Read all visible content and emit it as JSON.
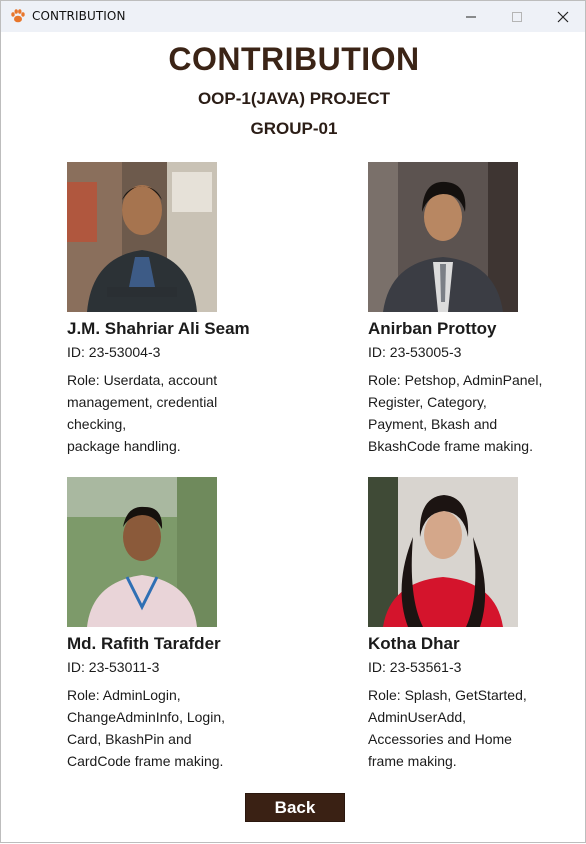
{
  "window": {
    "title": "CONTRIBUTION"
  },
  "header": {
    "title": "CONTRIBUTION",
    "subtitle": "OOP-1(JAVA) PROJECT",
    "group": "GROUP-01"
  },
  "members": [
    {
      "name": "J.M. Shahriar Ali Seam",
      "id": "ID: 23-53004-3",
      "role": "Role: Userdata, account\nmanagement, credential\nchecking,\npackage handling."
    },
    {
      "name": "Anirban Prottoy",
      "id": "ID: 23-53005-3",
      "role": "Role: Petshop, AdminPanel,\nRegister, Category,\nPayment, Bkash and\nBkashCode frame making."
    },
    {
      "name": "Md. Rafith Tarafder",
      "id": "ID: 23-53011-3",
      "role": "Role: AdminLogin,\nChangeAdminInfo, Login,\nCard, BkashPin and\nCardCode frame making."
    },
    {
      "name": "Kotha Dhar",
      "id": "ID: 23-53561-3",
      "role": "Role: Splash, GetStarted,\nAdminUserAdd,\nAccessories and Home\nframe making."
    }
  ],
  "footer": {
    "back_label": "Back"
  },
  "colors": {
    "accent": "#3a2114",
    "title": "#3b2416"
  }
}
